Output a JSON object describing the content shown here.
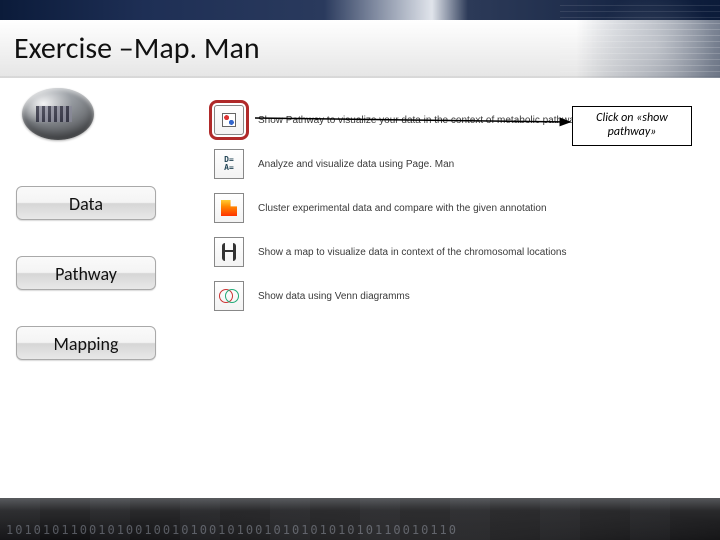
{
  "title": "Exercise –Map. Man",
  "sidebar": {
    "items": [
      {
        "label": "Data"
      },
      {
        "label": "Pathway"
      },
      {
        "label": "Mapping"
      }
    ]
  },
  "options": [
    {
      "label": "Show Pathway to visualize your data in the context of metabolic pathways",
      "highlighted": true,
      "icon": "pathway"
    },
    {
      "label": "Analyze and visualize data using Page. Man",
      "highlighted": false,
      "icon": "pageman"
    },
    {
      "label": "Cluster experimental data and compare with the given annotation",
      "highlighted": false,
      "icon": "cluster"
    },
    {
      "label": "Show a map to visualize data in context of the chromosomal locations",
      "highlighted": false,
      "icon": "chrom"
    },
    {
      "label": "Show data using Venn diagramms",
      "highlighted": false,
      "icon": "venn"
    }
  ],
  "callout": "Click on «show pathway»",
  "footer_binary": "1010101100101001001010010100101010101010110010110"
}
